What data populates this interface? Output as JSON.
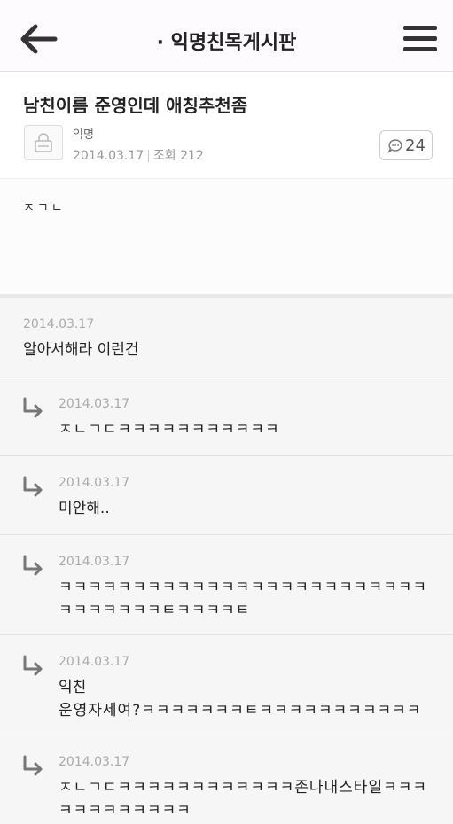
{
  "header": {
    "title": "· 익명친목게시판",
    "back_icon": "back-arrow-icon",
    "menu_icon": "hamburger-menu-icon"
  },
  "post": {
    "title": "남친이름 준영인데 애칭추천좀",
    "author": "익명",
    "date": "2014.03.17",
    "views_label": "조회 212",
    "comment_count": "24",
    "body": "ㅈㄱㄴ"
  },
  "comments": [
    {
      "date": "2014.03.17",
      "text": "알아서해라 이런건",
      "reply": false
    },
    {
      "date": "2014.03.17",
      "text": "ㅈㄴㄱㄷㅋㅋㅋㅋㅋㅋㅋㅋㅋㅋㅋ",
      "reply": true
    },
    {
      "date": "2014.03.17",
      "text": "미안해..",
      "reply": true
    },
    {
      "date": "2014.03.17",
      "line1": "ㅋㅋㅋㅋㅋㅋㅋㅋㅋㅋㅋㅋㅋㅋㅋㅋㅋㅋㅋㅋㅋㅋㅋㅋㅋ",
      "line2": "ㅋㅋㅋㅋㅋㅋㅋㅌㅋㅋㅋㅋㅌ",
      "reply": true
    },
    {
      "date": "2014.03.17",
      "line1": "익친",
      "line2": "운영자세여?ㅋㅋㅋㅋㅋㅋㅋㅌㅋㅋㅋㅋㅋㅋㅋㅋㅋㅋㅋ",
      "reply": true
    },
    {
      "date": "2014.03.17",
      "line1": "ㅈㄴㄱㄷㅋㅋㅋㅋㅋㅋㅋㅋㅋㅋㅋㅋ존나내스타일ㅋㅋㅋ",
      "line2": "ㅋㅋㅋㅋㅋㅋㅋㅋㅋ",
      "reply": true
    }
  ]
}
